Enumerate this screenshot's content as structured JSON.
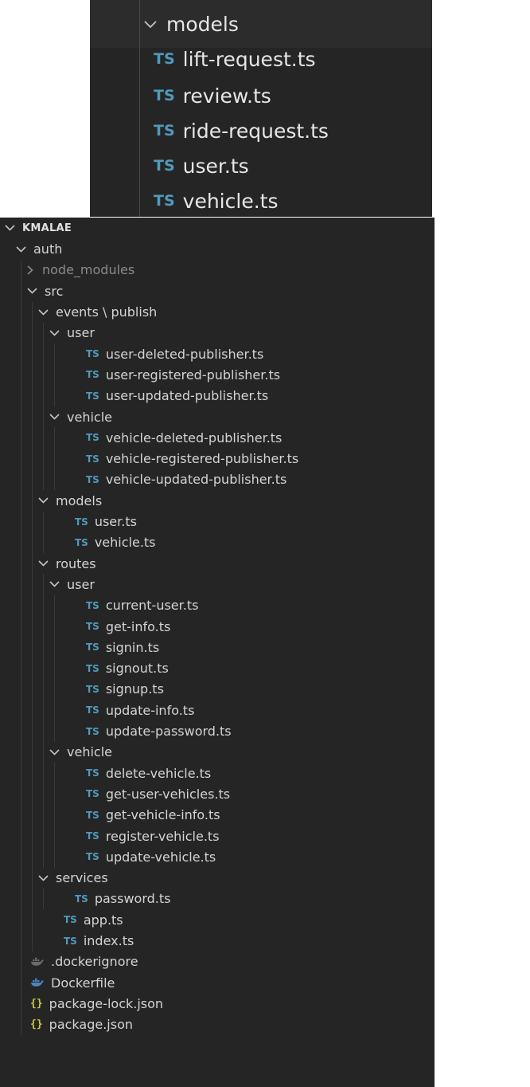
{
  "colors": {
    "background": "#252526",
    "text": "#d4d4d4",
    "typescript": "#519aba",
    "json": "#cbcb41",
    "docker": "#4d86c5",
    "dockerignore": "#6a6a6a"
  },
  "zoom_panel": {
    "folder": "models",
    "files": [
      {
        "badge": "TS",
        "name": "lift-request.ts"
      },
      {
        "badge": "TS",
        "name": "review.ts"
      },
      {
        "badge": "TS",
        "name": "ride-request.ts"
      },
      {
        "badge": "TS",
        "name": "user.ts"
      },
      {
        "badge": "TS",
        "name": "vehicle.ts"
      }
    ]
  },
  "explorer": {
    "root": "KMALAE",
    "rows": [
      {
        "type": "folder",
        "expanded": true,
        "label": "auth",
        "depth": 1
      },
      {
        "type": "folder",
        "expanded": false,
        "label": "node_modules",
        "depth": 2,
        "dim": true
      },
      {
        "type": "folder",
        "expanded": true,
        "label": "src",
        "depth": 2
      },
      {
        "type": "folder",
        "expanded": true,
        "label": "events \\ publish",
        "depth": 3
      },
      {
        "type": "folder",
        "expanded": true,
        "label": "user",
        "depth": 4
      },
      {
        "type": "file",
        "badge": "TS",
        "label": "user-deleted-publisher.ts",
        "depth": 5
      },
      {
        "type": "file",
        "badge": "TS",
        "label": "user-registered-publisher.ts",
        "depth": 5
      },
      {
        "type": "file",
        "badge": "TS",
        "label": "user-updated-publisher.ts",
        "depth": 5
      },
      {
        "type": "folder",
        "expanded": true,
        "label": "vehicle",
        "depth": 4
      },
      {
        "type": "file",
        "badge": "TS",
        "label": "vehicle-deleted-publisher.ts",
        "depth": 5
      },
      {
        "type": "file",
        "badge": "TS",
        "label": "vehicle-registered-publisher.ts",
        "depth": 5
      },
      {
        "type": "file",
        "badge": "TS",
        "label": "vehicle-updated-publisher.ts",
        "depth": 5
      },
      {
        "type": "folder",
        "expanded": true,
        "label": "models",
        "depth": 3
      },
      {
        "type": "file",
        "badge": "TS",
        "label": "user.ts",
        "depth": 4
      },
      {
        "type": "file",
        "badge": "TS",
        "label": "vehicle.ts",
        "depth": 4
      },
      {
        "type": "folder",
        "expanded": true,
        "label": "routes",
        "depth": 3
      },
      {
        "type": "folder",
        "expanded": true,
        "label": "user",
        "depth": 4
      },
      {
        "type": "file",
        "badge": "TS",
        "label": "current-user.ts",
        "depth": 5
      },
      {
        "type": "file",
        "badge": "TS",
        "label": "get-info.ts",
        "depth": 5
      },
      {
        "type": "file",
        "badge": "TS",
        "label": "signin.ts",
        "depth": 5
      },
      {
        "type": "file",
        "badge": "TS",
        "label": "signout.ts",
        "depth": 5
      },
      {
        "type": "file",
        "badge": "TS",
        "label": "signup.ts",
        "depth": 5
      },
      {
        "type": "file",
        "badge": "TS",
        "label": "update-info.ts",
        "depth": 5
      },
      {
        "type": "file",
        "badge": "TS",
        "label": "update-password.ts",
        "depth": 5
      },
      {
        "type": "folder",
        "expanded": true,
        "label": "vehicle",
        "depth": 4
      },
      {
        "type": "file",
        "badge": "TS",
        "label": "delete-vehicle.ts",
        "depth": 5
      },
      {
        "type": "file",
        "badge": "TS",
        "label": "get-user-vehicles.ts",
        "depth": 5
      },
      {
        "type": "file",
        "badge": "TS",
        "label": "get-vehicle-info.ts",
        "depth": 5
      },
      {
        "type": "file",
        "badge": "TS",
        "label": "register-vehicle.ts",
        "depth": 5
      },
      {
        "type": "file",
        "badge": "TS",
        "label": "update-vehicle.ts",
        "depth": 5
      },
      {
        "type": "folder",
        "expanded": true,
        "label": "services",
        "depth": 3
      },
      {
        "type": "file",
        "badge": "TS",
        "label": "password.ts",
        "depth": 4
      },
      {
        "type": "file",
        "badge": "TS",
        "label": "app.ts",
        "depth": 3
      },
      {
        "type": "file",
        "badge": "TS",
        "label": "index.ts",
        "depth": 3
      },
      {
        "type": "file",
        "icon": "dockerignore-icon",
        "label": ".dockerignore",
        "depth": 2
      },
      {
        "type": "file",
        "icon": "docker-icon",
        "label": "Dockerfile",
        "depth": 2
      },
      {
        "type": "file",
        "icon": "json-icon",
        "badge": "{}",
        "label": "package-lock.json",
        "depth": 2
      },
      {
        "type": "file",
        "icon": "json-icon",
        "badge": "{}",
        "label": "package.json",
        "depth": 2
      }
    ]
  }
}
